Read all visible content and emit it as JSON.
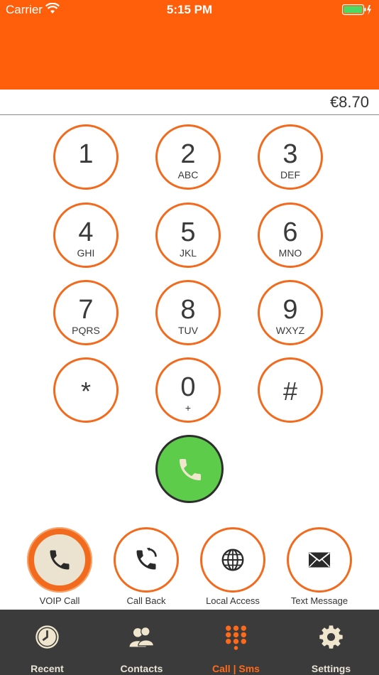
{
  "status": {
    "carrier": "Carrier",
    "time": "5:15 PM"
  },
  "balance": "€8.70",
  "keypad": [
    {
      "digit": "1",
      "letters": ""
    },
    {
      "digit": "2",
      "letters": "ABC"
    },
    {
      "digit": "3",
      "letters": "DEF"
    },
    {
      "digit": "4",
      "letters": "GHI"
    },
    {
      "digit": "5",
      "letters": "JKL"
    },
    {
      "digit": "6",
      "letters": "MNO"
    },
    {
      "digit": "7",
      "letters": "PQRS"
    },
    {
      "digit": "8",
      "letters": "TUV"
    },
    {
      "digit": "9",
      "letters": "WXYZ"
    },
    {
      "digit": "*",
      "letters": ""
    },
    {
      "digit": "0",
      "letters": "+"
    },
    {
      "digit": "#",
      "letters": ""
    }
  ],
  "modes": [
    {
      "label": "VOIP Call",
      "icon": "phone-icon",
      "active": true
    },
    {
      "label": "Call Back",
      "icon": "call-back-icon",
      "active": false
    },
    {
      "label": "Local Access",
      "icon": "globe-icon",
      "active": false
    },
    {
      "label": "Text Message",
      "icon": "envelope-icon",
      "active": false
    }
  ],
  "tabs": [
    {
      "label": "Recent",
      "icon": "clock-icon",
      "active": false
    },
    {
      "label": "Contacts",
      "icon": "contacts-icon",
      "active": false
    },
    {
      "label": "Call | Sms",
      "icon": "dialpad-icon",
      "active": true
    },
    {
      "label": "Settings",
      "icon": "gear-icon",
      "active": false
    }
  ],
  "colors": {
    "accent": "#ff5f0a",
    "call_green": "#5ccc4a",
    "tabbar": "#3b3b3b",
    "tab_active": "#ff6a1a"
  }
}
